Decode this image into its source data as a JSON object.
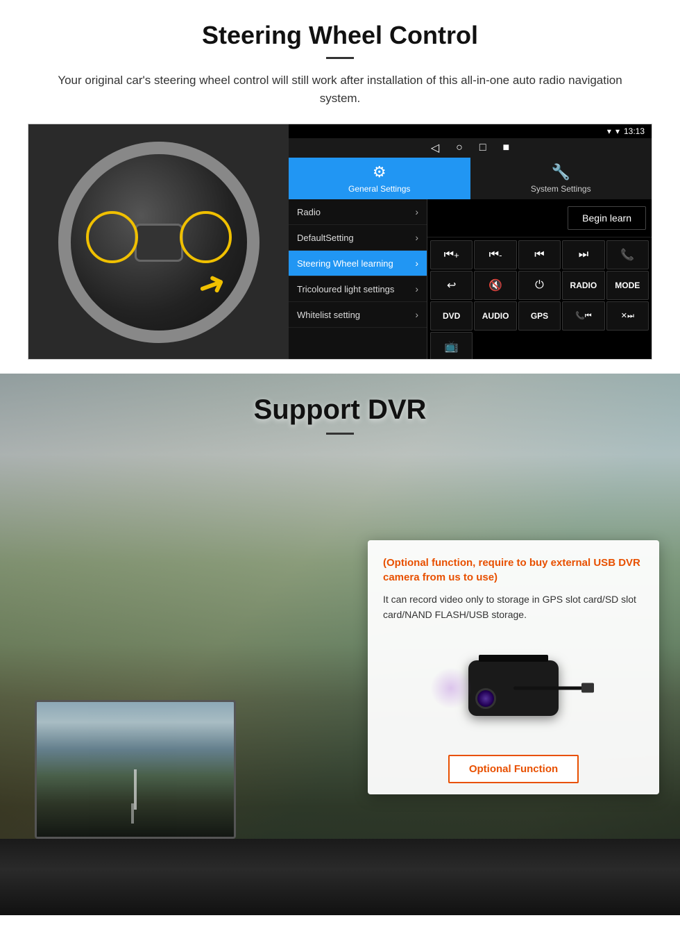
{
  "steering": {
    "title": "Steering Wheel Control",
    "description": "Your original car's steering wheel control will still work after installation of this all-in-one auto radio navigation system.",
    "android_ui": {
      "status_bar": {
        "signal": "▼",
        "wifi": "▾",
        "time": "13:13"
      },
      "nav_buttons": [
        "◁",
        "○",
        "□",
        "■"
      ],
      "tabs": [
        {
          "label": "General Settings",
          "icon": "⚙",
          "active": true
        },
        {
          "label": "System Settings",
          "icon": "🔧",
          "active": false
        }
      ],
      "menu_items": [
        {
          "label": "Radio",
          "active": false
        },
        {
          "label": "DefaultSetting",
          "active": false
        },
        {
          "label": "Steering Wheel learning",
          "active": true
        },
        {
          "label": "Tricoloured light settings",
          "active": false
        },
        {
          "label": "Whitelist setting",
          "active": false
        }
      ],
      "begin_learn_label": "Begin learn",
      "controls": [
        {
          "symbol": "⏮+",
          "label": "vol up"
        },
        {
          "symbol": "⏮-",
          "label": "vol down"
        },
        {
          "symbol": "⏮",
          "label": "prev"
        },
        {
          "symbol": "⏭",
          "label": "next"
        },
        {
          "symbol": "📞",
          "label": "call"
        },
        {
          "symbol": "↩",
          "label": "hangup"
        },
        {
          "symbol": "🔇",
          "label": "mute"
        },
        {
          "symbol": "⏻",
          "label": "power"
        },
        {
          "symbol": "RADIO",
          "label": "radio",
          "isText": true
        },
        {
          "symbol": "MODE",
          "label": "mode",
          "isText": true
        },
        {
          "symbol": "DVD",
          "label": "dvd",
          "isText": true
        },
        {
          "symbol": "AUDIO",
          "label": "audio",
          "isText": true
        },
        {
          "symbol": "GPS",
          "label": "gps",
          "isText": true
        },
        {
          "symbol": "📞⏮",
          "label": "tel prev"
        },
        {
          "symbol": "✕⏭",
          "label": "tel next"
        },
        {
          "symbol": "📺",
          "label": "screen"
        }
      ]
    }
  },
  "dvr": {
    "title": "Support DVR",
    "optional_text": "(Optional function, require to buy external USB DVR camera from us to use)",
    "description": "It can record video only to storage in GPS slot card/SD slot card/NAND FLASH/USB storage.",
    "optional_function_label": "Optional Function"
  }
}
